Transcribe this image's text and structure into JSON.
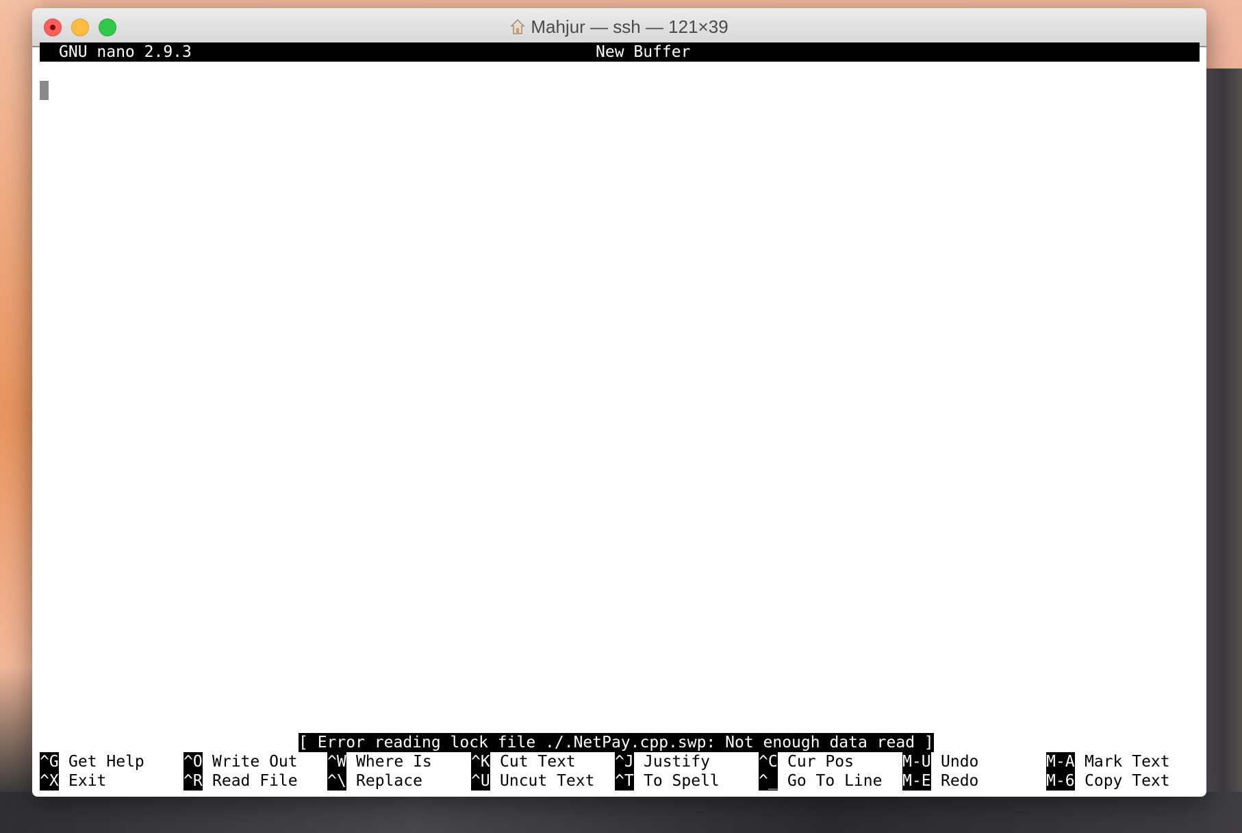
{
  "window": {
    "title": "Mahjur — ssh — 121×39",
    "title_icon": "home-icon"
  },
  "nano": {
    "version": "GNU nano 2.9.3",
    "buffer": "New Buffer",
    "status": "[ Error reading lock file ./.NetPay.cpp.swp: Not enough data read ]",
    "shortcuts": [
      [
        {
          "key": "^G",
          "label": "Get Help"
        },
        {
          "key": "^X",
          "label": "Exit"
        }
      ],
      [
        {
          "key": "^O",
          "label": "Write Out"
        },
        {
          "key": "^R",
          "label": "Read File"
        }
      ],
      [
        {
          "key": "^W",
          "label": "Where Is"
        },
        {
          "key": "^\\",
          "label": "Replace"
        }
      ],
      [
        {
          "key": "^K",
          "label": "Cut Text"
        },
        {
          "key": "^U",
          "label": "Uncut Text"
        }
      ],
      [
        {
          "key": "^J",
          "label": "Justify"
        },
        {
          "key": "^T",
          "label": "To Spell"
        }
      ],
      [
        {
          "key": "^C",
          "label": "Cur Pos"
        },
        {
          "key": "^_",
          "label": "Go To Line"
        }
      ],
      [
        {
          "key": "M-U",
          "label": "Undo"
        },
        {
          "key": "M-E",
          "label": "Redo"
        }
      ],
      [
        {
          "key": "M-A",
          "label": "Mark Text"
        },
        {
          "key": "M-6",
          "label": "Copy Text"
        }
      ]
    ]
  }
}
